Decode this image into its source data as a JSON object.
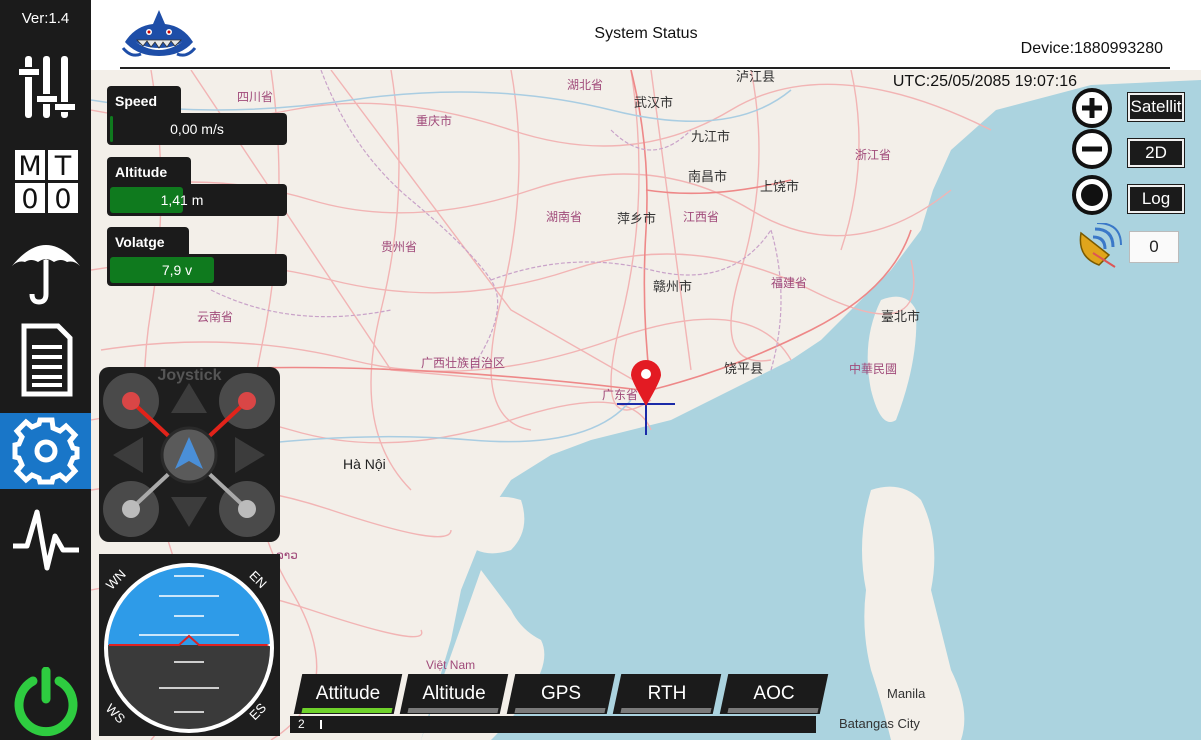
{
  "app": {
    "version": "Ver:1.4",
    "title": "System Status",
    "device": "Device:1880993280",
    "utc": "UTC:25/05/2085 19:07:16"
  },
  "sidebar": {
    "items": [
      {
        "name": "mixer-sliders",
        "icon": "sliders-icon",
        "active": false
      },
      {
        "name": "mode-mt-00",
        "icon": "mt-00-icon",
        "label": "MT 00",
        "active": false
      },
      {
        "name": "umbrella",
        "icon": "umbrella-icon",
        "active": false
      },
      {
        "name": "document",
        "icon": "document-icon",
        "active": false
      },
      {
        "name": "settings",
        "icon": "gear-icon",
        "active": true
      },
      {
        "name": "signal",
        "icon": "waveform-icon",
        "active": false
      }
    ],
    "power_icon": "power-icon"
  },
  "telemetry": {
    "speed": {
      "label": "Speed",
      "value": "0,00 m/s",
      "fill": 0.02
    },
    "altitude": {
      "label": "Altitude",
      "value": "1,41 m",
      "fill": 0.42
    },
    "voltage": {
      "label": "Volatge",
      "value": "7,9 v",
      "fill": 0.6
    }
  },
  "map_controls": {
    "zoom_in_icon": "plus-circle-icon",
    "zoom_out_icon": "minus-circle-icon",
    "center_icon": "target-circle-icon",
    "satellite_label": "Satellit",
    "view_label": "2D",
    "log_label": "Log",
    "satellite_icon": "satellite-dish-icon",
    "satellite_count": "0"
  },
  "joystick": {
    "label": "Joystick"
  },
  "attitude": {
    "labels": [
      "WN",
      "EN",
      "WS",
      "ES"
    ]
  },
  "map_labels": [
    {
      "text": "泸江县",
      "cls": "city"
    },
    {
      "text": "湖北省",
      "cls": "prov"
    },
    {
      "text": "武汉市",
      "cls": "city"
    },
    {
      "text": "四川省",
      "cls": "prov"
    },
    {
      "text": "重庆市",
      "cls": "prov"
    },
    {
      "text": "九江市",
      "cls": "city"
    },
    {
      "text": "浙江省",
      "cls": "prov"
    },
    {
      "text": "南昌市",
      "cls": "city"
    },
    {
      "text": "上饶市",
      "cls": "city"
    },
    {
      "text": "湖南省",
      "cls": "prov"
    },
    {
      "text": "萍乡市",
      "cls": "city"
    },
    {
      "text": "江西省",
      "cls": "prov"
    },
    {
      "text": "贵州省",
      "cls": "prov"
    },
    {
      "text": "赣州市",
      "cls": "city"
    },
    {
      "text": "福建省",
      "cls": "prov"
    },
    {
      "text": "云南省",
      "cls": "prov"
    },
    {
      "text": "臺北市",
      "cls": "city"
    },
    {
      "text": "广西壮族自治区",
      "cls": "prov"
    },
    {
      "text": "饶平县",
      "cls": "city"
    },
    {
      "text": "中華民國",
      "cls": "prov"
    },
    {
      "text": "广东省",
      "cls": "prov"
    },
    {
      "text": "Hà Nội",
      "cls": "big"
    },
    {
      "text": "ລາວ",
      "cls": "prov"
    },
    {
      "text": "Việt Nam",
      "cls": "prov"
    },
    {
      "text": "Manila",
      "cls": "city"
    },
    {
      "text": "Batangas City",
      "cls": "city"
    }
  ],
  "bottom_tabs": [
    {
      "label": "Attitude",
      "active": true
    },
    {
      "label": "Altitude",
      "active": false
    },
    {
      "label": "GPS",
      "active": false
    },
    {
      "label": "RTH",
      "active": false
    },
    {
      "label": "AOC",
      "active": false
    }
  ],
  "progress": {
    "value": "2"
  },
  "colors": {
    "sidebar": "#1b1b1b",
    "active": "#1976c8",
    "power": "#2ecc40",
    "fill": "#0f7a1e",
    "tab_active": "#6fd22b",
    "marker": "#e31b23"
  }
}
